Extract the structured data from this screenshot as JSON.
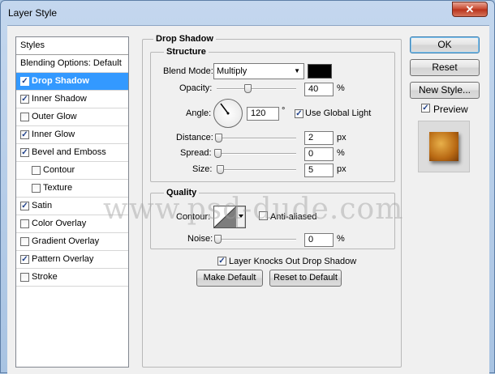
{
  "window": {
    "title": "Layer Style",
    "close_glyph": "✕"
  },
  "styles_panel": {
    "header": "Styles",
    "items": [
      {
        "label": "Blending Options: Default",
        "checkbox": false,
        "checked": false,
        "indent": false
      },
      {
        "label": "Drop Shadow",
        "checkbox": true,
        "checked": true,
        "indent": false,
        "selected": true
      },
      {
        "label": "Inner Shadow",
        "checkbox": true,
        "checked": true,
        "indent": false
      },
      {
        "label": "Outer Glow",
        "checkbox": true,
        "checked": false,
        "indent": false
      },
      {
        "label": "Inner Glow",
        "checkbox": true,
        "checked": true,
        "indent": false
      },
      {
        "label": "Bevel and Emboss",
        "checkbox": true,
        "checked": true,
        "indent": false
      },
      {
        "label": "Contour",
        "checkbox": true,
        "checked": false,
        "indent": true
      },
      {
        "label": "Texture",
        "checkbox": true,
        "checked": false,
        "indent": true
      },
      {
        "label": "Satin",
        "checkbox": true,
        "checked": true,
        "indent": false
      },
      {
        "label": "Color Overlay",
        "checkbox": true,
        "checked": false,
        "indent": false
      },
      {
        "label": "Gradient Overlay",
        "checkbox": true,
        "checked": false,
        "indent": false
      },
      {
        "label": "Pattern Overlay",
        "checkbox": true,
        "checked": true,
        "indent": false
      },
      {
        "label": "Stroke",
        "checkbox": true,
        "checked": false,
        "indent": false
      }
    ]
  },
  "drop_shadow": {
    "section_title": "Drop Shadow",
    "structure": {
      "title": "Structure",
      "blend_mode_label": "Blend Mode:",
      "blend_mode_value": "Multiply",
      "shadow_color": "#000000",
      "opacity_label": "Opacity:",
      "opacity_value": "40",
      "opacity_unit": "%",
      "angle_label": "Angle:",
      "angle_value": "120",
      "angle_unit": "°",
      "use_global_light_label": "Use Global Light",
      "use_global_light_checked": true,
      "distance_label": "Distance:",
      "distance_value": "2",
      "distance_unit": "px",
      "spread_label": "Spread:",
      "spread_value": "0",
      "spread_unit": "%",
      "size_label": "Size:",
      "size_value": "5",
      "size_unit": "px"
    },
    "quality": {
      "title": "Quality",
      "contour_label": "Contour:",
      "anti_aliased_label": "Anti-aliased",
      "anti_aliased_checked": false,
      "noise_label": "Noise:",
      "noise_value": "0",
      "noise_unit": "%"
    },
    "knocks_out_label": "Layer Knocks Out Drop Shadow",
    "knocks_out_checked": true,
    "make_default_label": "Make Default",
    "reset_to_default_label": "Reset to Default"
  },
  "buttons": {
    "ok": "OK",
    "reset": "Reset",
    "new_style": "New Style...",
    "preview_label": "Preview",
    "preview_checked": true
  },
  "watermark": "www.psd-dude.com",
  "check_glyph": "✓",
  "dropdown_glyph": "▼"
}
